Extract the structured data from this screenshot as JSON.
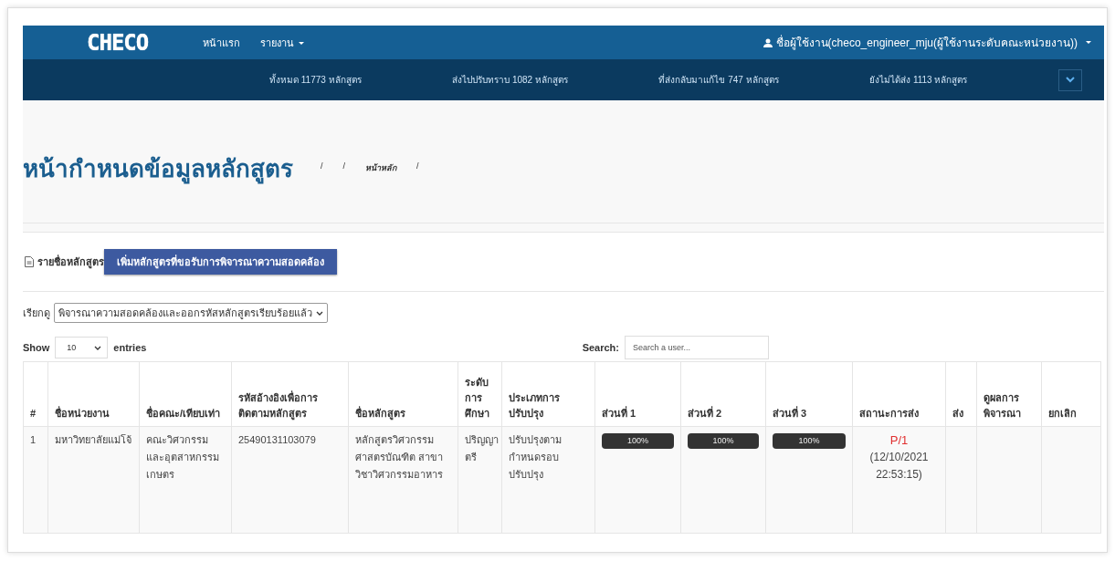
{
  "navbar": {
    "logo": "CHECO",
    "menu": [
      {
        "label": "หน้าแรก",
        "dropdown": false
      },
      {
        "label": "รายงาน",
        "dropdown": true
      }
    ],
    "user": "ชื่อผู้ใช้งาน(checo_engineer_mju(ผู้ใช้งานระดับคณะหน่วยงาน))"
  },
  "stats": [
    "ทั้งหมด 11773 หลักสูตร",
    "ส่งไปปรับทราบ 1082 หลักสูตร",
    "ที่ส่งกลับมาแก้ไข 747 หลักสูตร",
    "ยังไม่ได้ส่ง 1113 หลักสูตร"
  ],
  "page_title": "หน้ากำหนดข้อมูลหลักสูตร",
  "breadcrumb": [
    "/",
    "/",
    "หน้าหลัก",
    "/"
  ],
  "list_label": "รายชื่อหลักสูตร",
  "add_button": "เพิ่มหลักสูตรที่ขอรับการพิจารณาความสอดคล้อง",
  "filter": {
    "label": "เรียกดู",
    "value": "พิจารณาความสอดคล้องและออกรหัสหลักสูตรเรียบร้อยแล้ว"
  },
  "length": {
    "before": "Show",
    "value": "10",
    "after": "entries"
  },
  "search": {
    "label": "Search:",
    "placeholder": "Search a user..."
  },
  "table": {
    "columns": [
      "#",
      "ชื่อหน่วยงาน",
      "ชื่อคณะ/เทียบเท่า",
      "รหัสอ้างอิงเพื่อการติดตามหลักสูตร",
      "ชื่อหลักสูตร",
      "ระดับการศึกษา",
      "ประเภทการปรับปรุง",
      "ส่วนที่ 1",
      "ส่วนที่ 2",
      "ส่วนที่ 3",
      "สถานะการส่ง",
      "ส่ง",
      "ดูผลการพิจารณา",
      "ยกเลิก"
    ],
    "rows": [
      {
        "cells": [
          "1",
          "มหาวิทยาลัยแม่โจ้",
          "คณะวิศวกรรมและอุตสาหกรรมเกษตร",
          "25490131103079",
          "หลักสูตรวิศวกรรมศาสตรบัณฑิต สาขาวิชาวิศวกรรมอาหาร",
          "ปริญญาตรี",
          "ปรับปรุงตามกำหนดรอบปรับปรุง"
        ],
        "parts": [
          {
            "level": 1,
            "label": "100%"
          },
          {
            "level": 1,
            "label": "100%"
          },
          {
            "level": 1,
            "label": "100%"
          }
        ],
        "status": {
          "code": "P/1",
          "time": "(12/10/2021 22:53:15)"
        }
      }
    ]
  }
}
